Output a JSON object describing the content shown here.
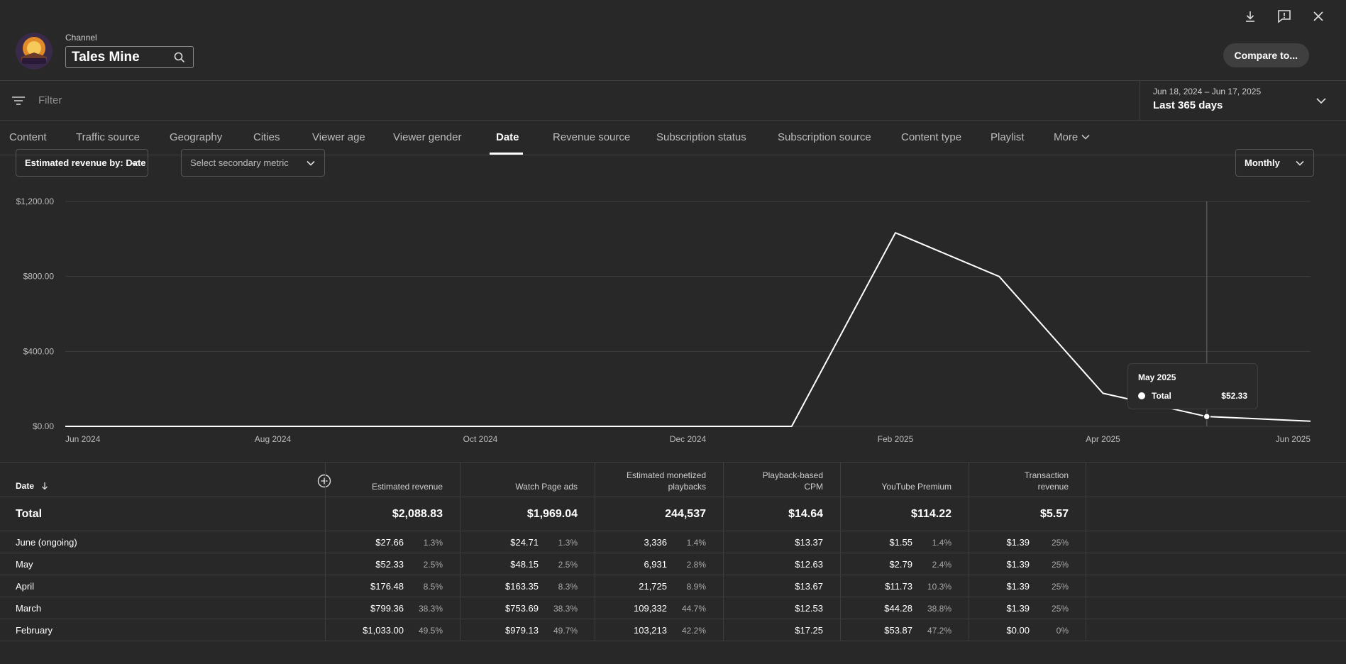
{
  "header": {
    "channel_label": "Channel",
    "channel_name": "Tales Mine",
    "compare_label": "Compare to...",
    "avatar_text": "TALES MINE"
  },
  "filter": {
    "placeholder": "Filter",
    "date_range_sub": "Jun 18, 2024 – Jun 17, 2025",
    "date_range_main": "Last 365 days"
  },
  "tabs": [
    {
      "label": "Content"
    },
    {
      "label": "Traffic source"
    },
    {
      "label": "Geography"
    },
    {
      "label": "Cities"
    },
    {
      "label": "Viewer age"
    },
    {
      "label": "Viewer gender"
    },
    {
      "label": "Date",
      "active": true
    },
    {
      "label": "Revenue source"
    },
    {
      "label": "Subscription status"
    },
    {
      "label": "Subscription source"
    },
    {
      "label": "Content type"
    },
    {
      "label": "Playlist"
    },
    {
      "label": "More"
    }
  ],
  "controls": {
    "primary_metric": "Estimated revenue by: Date",
    "secondary_metric": "Select secondary metric",
    "granularity": "Monthly"
  },
  "chart_data": {
    "type": "line",
    "y_ticks": [
      "$0.00",
      "$400.00",
      "$800.00",
      "$1,200.00"
    ],
    "ylim": [
      0,
      1200
    ],
    "x_ticks": [
      "Jun 2024",
      "Aug 2024",
      "Oct 2024",
      "Dec 2024",
      "Feb 2025",
      "Apr 2025",
      "Jun 2025"
    ],
    "series": [
      {
        "name": "Total",
        "x": [
          "Jun 2024",
          "Jul 2024",
          "Aug 2024",
          "Sep 2024",
          "Oct 2024",
          "Nov 2024",
          "Dec 2024",
          "Jan 2025",
          "Feb 2025",
          "Mar 2025",
          "Apr 2025",
          "May 2025",
          "Jun 2025"
        ],
        "values": [
          0,
          0,
          0,
          0,
          0,
          0,
          0,
          0,
          1033.0,
          799.36,
          176.48,
          52.33,
          27.66
        ]
      }
    ],
    "highlight": {
      "x": "May 2025",
      "label": "May 2025",
      "series": "Total",
      "value": "$52.33"
    }
  },
  "table": {
    "date_header": "Date",
    "columns": [
      {
        "label": "Estimated revenue"
      },
      {
        "label": "Watch Page ads"
      },
      {
        "label": "Estimated monetized playbacks"
      },
      {
        "label": "Playback-based CPM"
      },
      {
        "label": "YouTube Premium"
      },
      {
        "label": "Transaction revenue"
      }
    ],
    "total": {
      "label": "Total",
      "values": [
        "$2,088.83",
        "$1,969.04",
        "244,537",
        "$14.64",
        "$114.22",
        "$5.57"
      ]
    },
    "rows": [
      {
        "label": "June (ongoing)",
        "values": [
          "$27.66",
          "$24.71",
          "3,336",
          "$13.37",
          "$1.55",
          "$1.39"
        ],
        "pcts": [
          "1.3%",
          "1.3%",
          "1.4%",
          "",
          "1.4%",
          "25%"
        ]
      },
      {
        "label": "May",
        "values": [
          "$52.33",
          "$48.15",
          "6,931",
          "$12.63",
          "$2.79",
          "$1.39"
        ],
        "pcts": [
          "2.5%",
          "2.5%",
          "2.8%",
          "",
          "2.4%",
          "25%"
        ]
      },
      {
        "label": "April",
        "values": [
          "$176.48",
          "$163.35",
          "21,725",
          "$13.67",
          "$11.73",
          "$1.39"
        ],
        "pcts": [
          "8.5%",
          "8.3%",
          "8.9%",
          "",
          "10.3%",
          "25%"
        ]
      },
      {
        "label": "March",
        "values": [
          "$799.36",
          "$753.69",
          "109,332",
          "$12.53",
          "$44.28",
          "$1.39"
        ],
        "pcts": [
          "38.3%",
          "38.3%",
          "44.7%",
          "",
          "38.8%",
          "25%"
        ]
      },
      {
        "label": "February",
        "values": [
          "$1,033.00",
          "$979.13",
          "103,213",
          "$17.25",
          "$53.87",
          "$0.00"
        ],
        "pcts": [
          "49.5%",
          "49.7%",
          "42.2%",
          "",
          "47.2%",
          "0%"
        ]
      }
    ]
  },
  "colors": {
    "background": "#282828",
    "line": "#ffffff",
    "grid": "#3e3e3e"
  }
}
